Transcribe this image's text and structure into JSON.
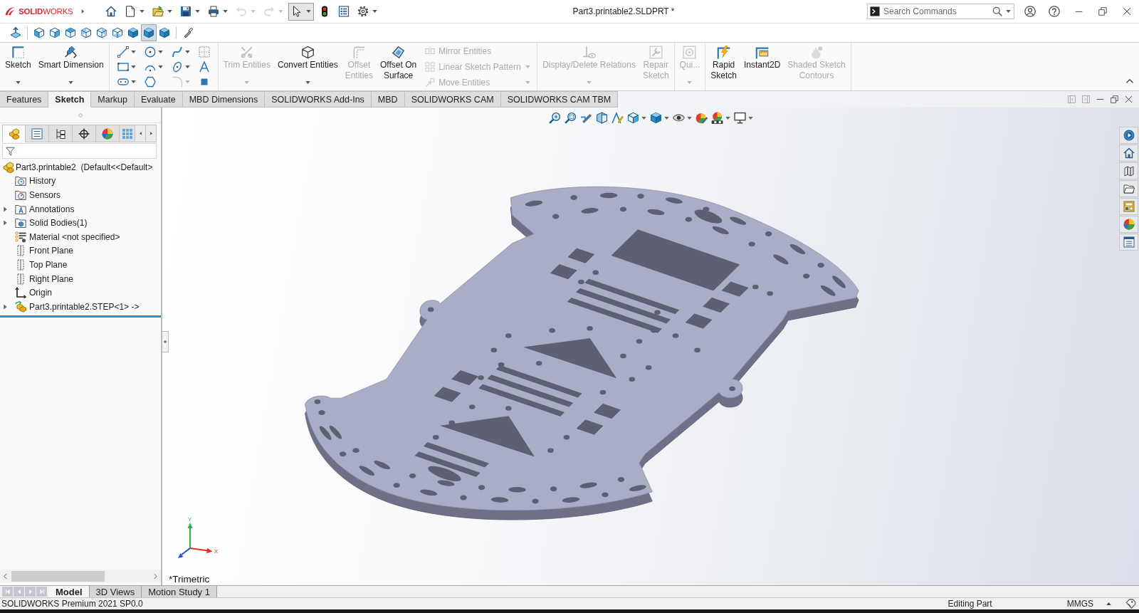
{
  "title_bar": {
    "logo": "**SOLID**WORKS",
    "quick_access": [
      {
        "dropdown": false,
        "disabled": false,
        "selected": false
      },
      {
        "dropdown": true,
        "disabled": false,
        "selected": false
      },
      {
        "dropdown": true,
        "disabled": false,
        "selected": false
      },
      {
        "dropdown": true,
        "disabled": false,
        "selected": false
      },
      {
        "dropdown": true,
        "disabled": false,
        "selected": false
      },
      {
        "dropdown": true,
        "disabled": true,
        "selected": false
      },
      {
        "dropdown": true,
        "disabled": true,
        "selected": false
      },
      {
        "dropdown": true,
        "disabled": false,
        "selected": true
      },
      {
        "dropdown": false,
        "disabled": false,
        "selected": false
      },
      {
        "dropdown": false,
        "disabled": false,
        "selected": false
      },
      {
        "dropdown": true,
        "disabled": false,
        "selected": false
      }
    ],
    "document_title": "Part3.printable2.SLDPRT *",
    "search": {
      "placeholder": "Search Commands"
    }
  },
  "view_toolbar": [
    {
      "selected": false
    },
    {
      "selected": false
    },
    {
      "selected": false
    },
    {
      "selected": false
    },
    {
      "selected": false
    },
    {
      "selected": false
    },
    {
      "selected": false
    },
    {
      "selected": false
    },
    {
      "selected": true
    },
    {
      "selected": false
    }
  ],
  "ribbon": {
    "groups": [
      {
        "kind": "buttons",
        "items": [
          {
            "label": "Sketch",
            "disabled": false,
            "dropdown": true
          },
          {
            "label": "Smart Dimension",
            "disabled": false,
            "dropdown": true
          }
        ]
      },
      {
        "kind": "grid"
      },
      {
        "kind": "buttons",
        "items": [
          {
            "label": "Trim Entities",
            "disabled": true,
            "dropdown": true
          },
          {
            "label": "Convert Entities",
            "disabled": false,
            "dropdown": true
          },
          {
            "label": "Offset\nEntities",
            "disabled": true,
            "dropdown": false
          },
          {
            "label": "Offset On\nSurface",
            "disabled": false,
            "dropdown": false
          }
        ],
        "stack": [
          {
            "label": "Mirror Entities",
            "disabled": true,
            "dropdown": false
          },
          {
            "label": "Linear Sketch Pattern",
            "disabled": true,
            "dropdown": true
          },
          {
            "label": "Move Entities",
            "disabled": true,
            "dropdown": true
          }
        ]
      },
      {
        "kind": "buttons",
        "items": [
          {
            "label": "Display/Delete Relations",
            "disabled": true,
            "dropdown": true
          },
          {
            "label": "Repair\nSketch",
            "disabled": true,
            "dropdown": false
          }
        ]
      },
      {
        "kind": "buttons",
        "items": [
          {
            "label": "Qui...",
            "disabled": true,
            "dropdown": true
          }
        ]
      },
      {
        "kind": "buttons",
        "items": [
          {
            "label": "Rapid\nSketch",
            "disabled": false,
            "dropdown": false
          },
          {
            "label": "Instant2D",
            "disabled": false,
            "dropdown": false
          },
          {
            "label": "Shaded Sketch\nContours",
            "disabled": true,
            "dropdown": false
          }
        ]
      }
    ]
  },
  "command_tabs": [
    {
      "label": "Features",
      "selected": false
    },
    {
      "label": "Sketch",
      "selected": true
    },
    {
      "label": "Markup",
      "selected": false
    },
    {
      "label": "Evaluate",
      "selected": false
    },
    {
      "label": "MBD Dimensions",
      "selected": false
    },
    {
      "label": "SOLIDWORKS Add-Ins",
      "selected": false
    },
    {
      "label": "MBD",
      "selected": false
    },
    {
      "label": "SOLIDWORKS CAM",
      "selected": false
    },
    {
      "label": "SOLIDWORKS CAM TBM",
      "selected": false
    }
  ],
  "feature_manager": {
    "panel_tabs": [
      {
        "selected": true
      },
      {
        "selected": false
      },
      {
        "selected": false
      },
      {
        "selected": false
      },
      {
        "selected": false
      },
      {
        "selected": false
      }
    ],
    "tree": {
      "label": "Part3.printable2  (Default<<Default>",
      "children": [
        {
          "label": "History",
          "kind": "history",
          "expandable": false
        },
        {
          "label": "Sensors",
          "kind": "sensors",
          "expandable": false
        },
        {
          "label": "Annotations",
          "kind": "annotations",
          "expandable": true
        },
        {
          "label": "Solid Bodies(1)",
          "kind": "bodies",
          "expandable": true
        },
        {
          "label": "Material <not specified>",
          "kind": "material",
          "expandable": false
        },
        {
          "label": "Front Plane",
          "kind": "plane",
          "expandable": false
        },
        {
          "label": "Top Plane",
          "kind": "plane",
          "expandable": false
        },
        {
          "label": "Right Plane",
          "kind": "plane",
          "expandable": false
        },
        {
          "label": "Origin",
          "kind": "origin",
          "expandable": false
        },
        {
          "label": "Part3.printable2.STEP<1> ->",
          "kind": "import",
          "expandable": true
        }
      ]
    }
  },
  "viewport": {
    "view_name": "*Trimetric",
    "axis_labels": [
      "Y",
      "X"
    ]
  },
  "bottom_tabs": [
    {
      "label": "Model",
      "selected": true
    },
    {
      "label": "3D Views",
      "selected": false
    },
    {
      "label": "Motion Study 1",
      "selected": false
    }
  ],
  "status_bar": {
    "product": "SOLIDWORKS Premium 2021 SP0.0",
    "mode": "Editing Part",
    "units": "MMGS"
  }
}
